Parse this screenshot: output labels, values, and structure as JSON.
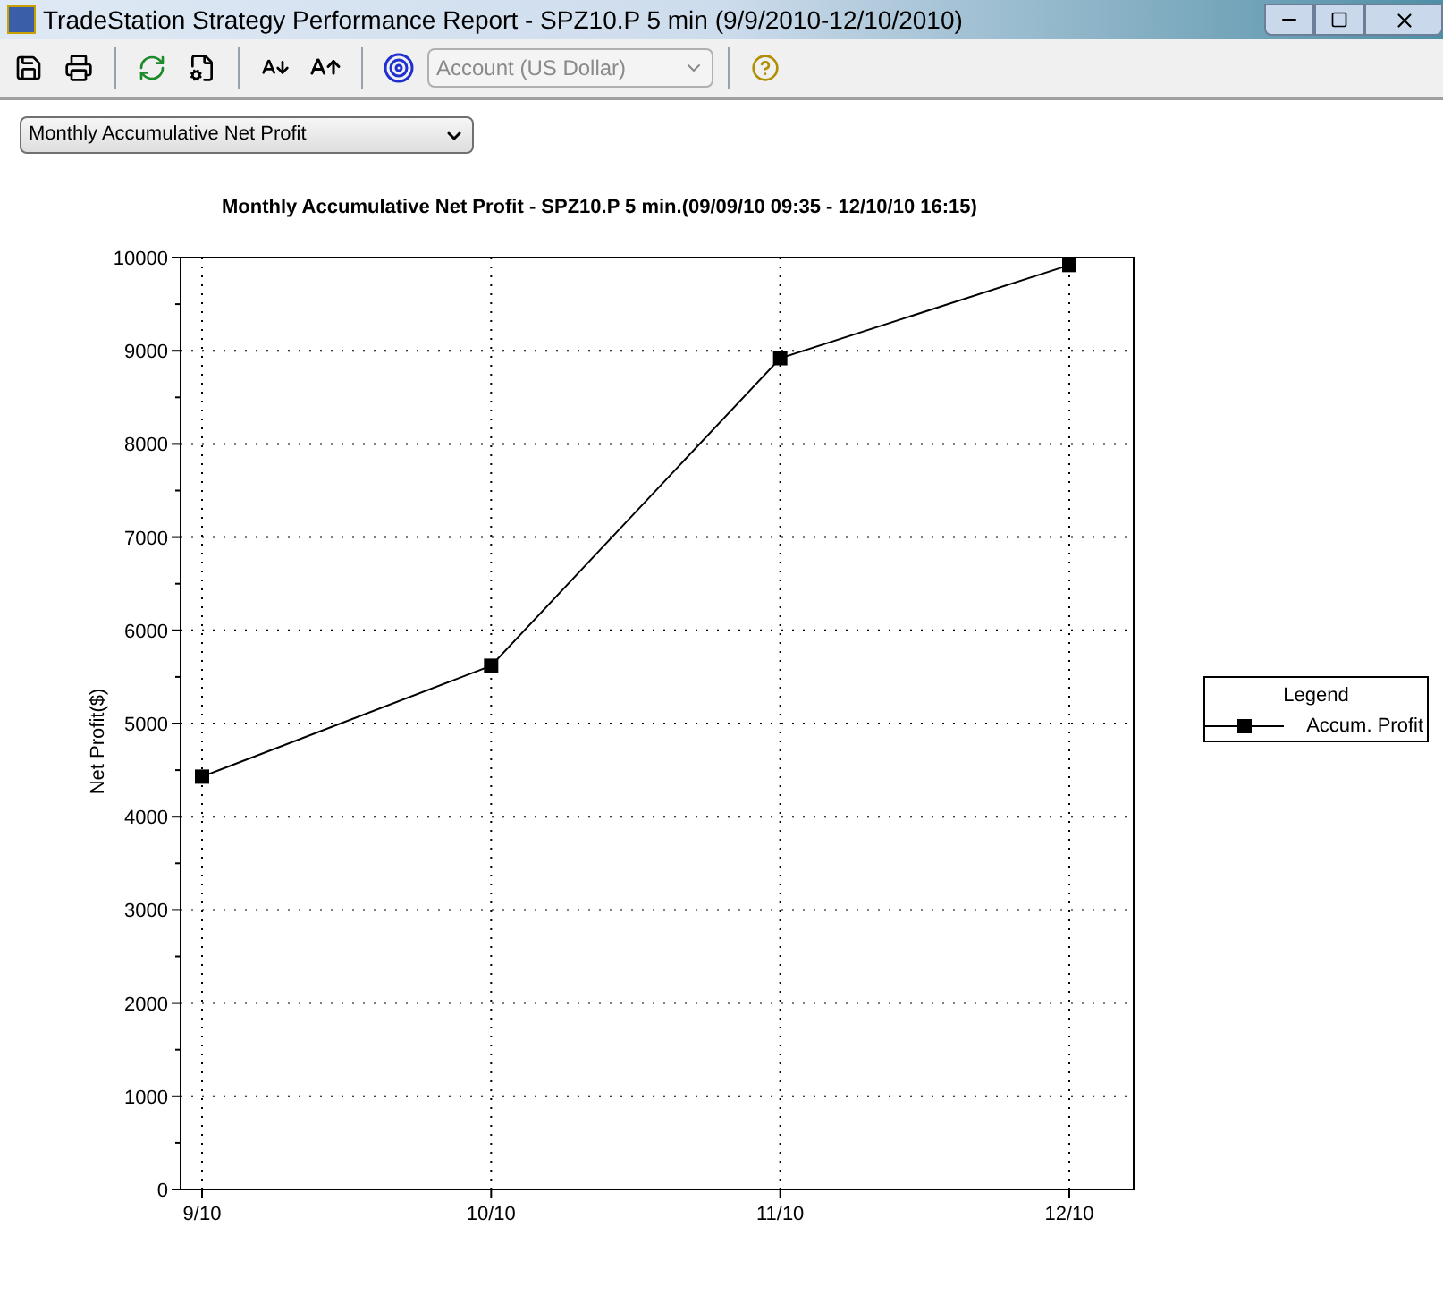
{
  "window": {
    "title": "TradeStation Strategy Performance Report - SPZ10.P 5 min (9/9/2010-12/10/2010)"
  },
  "toolbar": {
    "account_select": {
      "value": "Account (US Dollar)",
      "disabled": true
    }
  },
  "report_select": {
    "value": "Monthly Accumulative Net Profit"
  },
  "chart": {
    "title": "Monthly Accumulative Net Profit - SPZ10.P 5 min.(09/09/10 09:35 - 12/10/10 16:15)",
    "legend": {
      "title": "Legend"
    },
    "chart_data": {
      "type": "line",
      "ylabel": "Net Profit($)",
      "categories": [
        "9/10",
        "10/10",
        "11/10",
        "12/10"
      ],
      "ylim": [
        0,
        10000
      ],
      "yticks": [
        0,
        1000,
        2000,
        3000,
        4000,
        5000,
        6000,
        7000,
        8000,
        9000,
        10000
      ],
      "grid": true,
      "series": [
        {
          "name": "Accum. Profit",
          "color": "#000000",
          "marker": "square",
          "values": [
            4430,
            5620,
            8920,
            9920
          ]
        }
      ]
    }
  }
}
